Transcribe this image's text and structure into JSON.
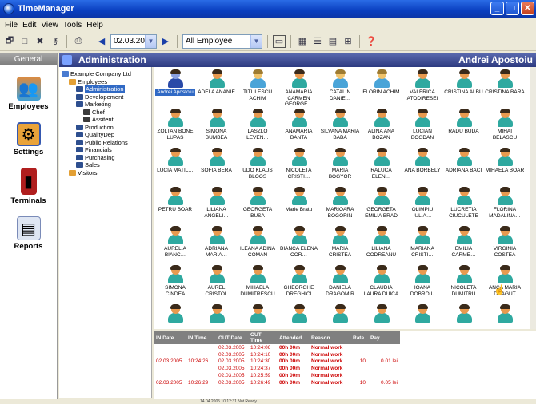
{
  "window": {
    "title": "TimeManager"
  },
  "menu": [
    "File",
    "Edit",
    "View",
    "Tools",
    "Help"
  ],
  "toolbar": {
    "date": "02.03.2005",
    "filter": "All Employee"
  },
  "sidebar": {
    "tab": "General",
    "items": [
      {
        "label": "Employees",
        "icon": "employees-icon"
      },
      {
        "label": "Settings",
        "icon": "settings-icon"
      },
      {
        "label": "Terminals",
        "icon": "terminals-icon"
      },
      {
        "label": "Reports",
        "icon": "reports-icon"
      }
    ]
  },
  "header": {
    "title": "Administration",
    "user": "Andrei Apostoiu"
  },
  "tree": [
    {
      "label": "Example Company Ltd",
      "indent": 0
    },
    {
      "label": "Employees",
      "indent": 1
    },
    {
      "label": "Administration",
      "indent": 2,
      "selected": true
    },
    {
      "label": "Developement",
      "indent": 2
    },
    {
      "label": "Marketing",
      "indent": 2
    },
    {
      "label": "Chef",
      "indent": 3
    },
    {
      "label": "Assitent",
      "indent": 3
    },
    {
      "label": "Production",
      "indent": 2
    },
    {
      "label": "QualityDep",
      "indent": 2
    },
    {
      "label": "Public Relations",
      "indent": 2
    },
    {
      "label": "Financials",
      "indent": 2
    },
    {
      "label": "Purchasing",
      "indent": 2
    },
    {
      "label": "Sales",
      "indent": 2
    },
    {
      "label": "Visitors",
      "indent": 1
    }
  ],
  "employees": [
    [
      "Andrei Apostoiu",
      "ADELA ANANIE",
      "TITULESCU ACHIM",
      "ANAMARIA CARMEN GEORGE…",
      "CATALIN DANIE…",
      "FLORIN ACHIM",
      "VALERICA ATODIRESEI",
      "CRISTINA ALBU",
      "CRISTINA BARA"
    ],
    [
      "ZOLTAN BONE LUPAS",
      "SIMONA BUMBEA",
      "LASZLO LEVEN…",
      "ANAMARIA BANTA",
      "SILVANA MARIA BABA",
      "ALINA ANA BOZAN",
      "LUCIAN BOGDAN",
      "RADU BUDA",
      "MIHAI BELASCU"
    ],
    [
      "LUCIA MATIL…",
      "SOFIA BERA",
      "UDO KLAUS BLOOS",
      "NICOLETA CRISTI…",
      "MARIA BOGYOR",
      "RALUCA ELEN…",
      "ANA BORBELY",
      "ADRIANA BACI",
      "MIHAELA BOAR"
    ],
    [
      "PETRU BOAR",
      "LILIANA ANGELI…",
      "GEORGETA BUSA",
      "Marie Bratu",
      "MARIOARA BOGORIN",
      "GEORGETA EMILIA BRAD",
      "OLIMPIU IULIA…",
      "LUCRETIA CIUCULETE",
      "FLORINA MADALINA…"
    ],
    [
      "AURELIA BIANC…",
      "ADRIANA MARIA…",
      "ILEANA ADINA COMAN",
      "BIANCA ELENA COR…",
      "MARIA CRISTEA",
      "LILIANA CODREANU",
      "MARIANA CRISTI…",
      "EMILIA CARME…",
      "VIRGINIA COSTEA"
    ],
    [
      "SIMONA CINDEA",
      "AUREL CRISTOL",
      "MIHAELA DUMITRESCU",
      "GHEORGHE DREGHICI",
      "DANIELA DRAGOMIR",
      "CLAUDIA LAURA DUICA",
      "IOANA DOBROIU",
      "NICOLETA DUMITRU",
      "ANCA MARIA DRAGUT"
    ]
  ],
  "attendance": {
    "headers": [
      "IN Date",
      "IN Time",
      "OUT Date",
      "OUT Time",
      "Attended",
      "Reason",
      "Rate",
      "Pay"
    ],
    "rows": [
      [
        "",
        "",
        "02.03.2005",
        "10:24:06",
        "00h 00m",
        "Normal work",
        "",
        ""
      ],
      [
        "",
        "",
        "02.03.2005",
        "10:24:10",
        "00h 00m",
        "Normal work",
        "",
        ""
      ],
      [
        "02.03.2005",
        "10:24:26",
        "02.03.2005",
        "10:24:30",
        "00h 00m",
        "Normal work",
        "10",
        "0.01 lei"
      ],
      [
        "",
        "",
        "02.03.2005",
        "10:24:37",
        "00h 00m",
        "Normal work",
        "",
        ""
      ],
      [
        "",
        "",
        "02.03.2005",
        "10:25:59",
        "00h 00m",
        "Normal work",
        "",
        ""
      ],
      [
        "02.03.2005",
        "10:26:29",
        "02.03.2005",
        "10:26:49",
        "00h 00m",
        "Normal work",
        "10",
        "0.05 lei"
      ]
    ]
  },
  "status": {
    "text": "14.04.2005 10:12:31       Not Ready"
  },
  "colors": {
    "title_bar": "#0a3fc0",
    "header": "#2d3a80",
    "attendance_text": "#cc0000",
    "selection": "#316ac5"
  }
}
